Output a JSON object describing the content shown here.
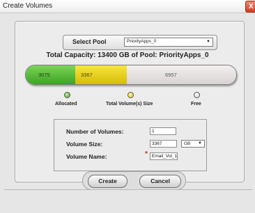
{
  "window": {
    "title": "Create Volumes",
    "close_label": "X"
  },
  "pool": {
    "label": "Select Pool",
    "selected": "PriorityApps_0"
  },
  "capacity_text": "Total Capacity: 13400 GB of Pool: PriorityApps_0",
  "usage_bar": {
    "allocated": "3075",
    "total_volume_size": "3367",
    "free": "6957",
    "colors": {
      "allocated": "#4fb52d",
      "total_volume_size": "#e8d20f",
      "free": "#e4dfdf"
    }
  },
  "legend": {
    "allocated": "Allocated",
    "total_volume_size": "Total Volume(s) Size",
    "free": "Free"
  },
  "form": {
    "num_volumes_label": "Number of Volumes:",
    "num_volumes_value": "1",
    "volume_size_label": "Volume Size:",
    "volume_size_value": "3367",
    "unit": "GB",
    "volume_name_label": "Volume Name:",
    "volume_name_value": "Email_Vol_1",
    "required_mark": "*"
  },
  "buttons": {
    "create": "Create",
    "cancel": "Cancel"
  }
}
